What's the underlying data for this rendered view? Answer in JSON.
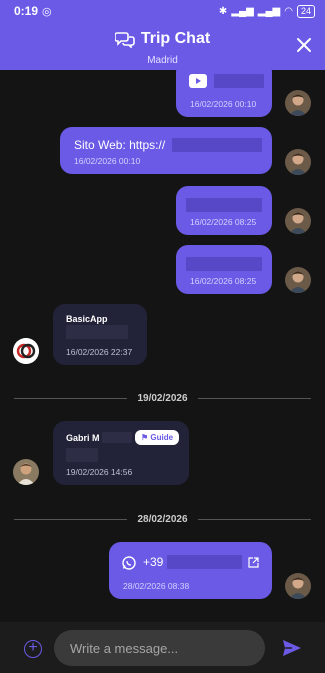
{
  "status_bar": {
    "time": "0:19",
    "battery": "24"
  },
  "header": {
    "title": "Trip Chat",
    "subtitle": "Madrid"
  },
  "messages": {
    "m1": {
      "timestamp": "16/02/2026 00:10"
    },
    "m2": {
      "text": "Sito Web: https://",
      "timestamp": "16/02/2026 00:10"
    },
    "m3": {
      "timestamp": "16/02/2026 08:25"
    },
    "m4": {
      "timestamp": "16/02/2026 08:25"
    },
    "m5": {
      "sender": "BasicApp",
      "timestamp": "16/02/2026 22:37"
    },
    "m6": {
      "sender": "Gabri M",
      "badge": "Guide",
      "timestamp": "19/02/2026 14:56"
    },
    "m7": {
      "text": "+39",
      "timestamp": "28/02/2026 08:38"
    }
  },
  "dividers": {
    "d1": "19/02/2026",
    "d2": "28/02/2026"
  },
  "composer": {
    "placeholder": "Write a message..."
  },
  "colors": {
    "accent": "#6a5ae6",
    "background": "#141414",
    "incoming": "#222238"
  }
}
